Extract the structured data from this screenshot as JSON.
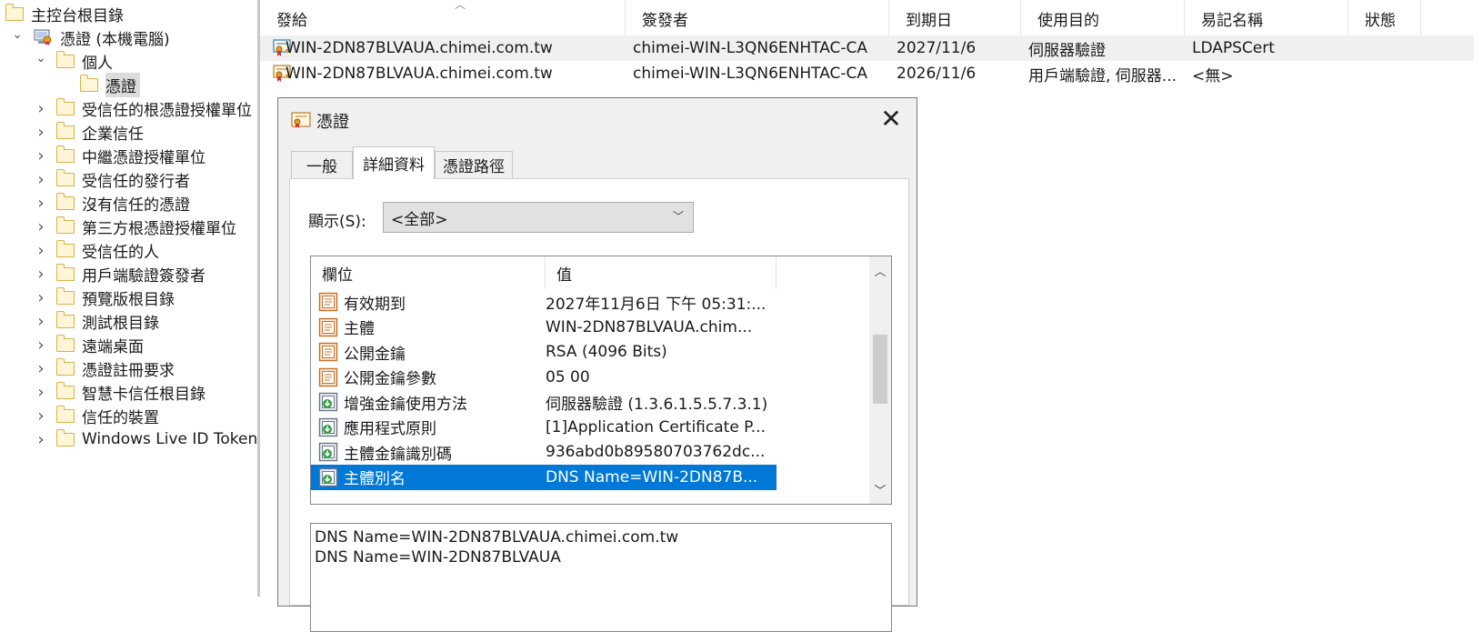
{
  "tree": {
    "items": [
      {
        "label": "主控台根目錄",
        "level": 0,
        "icon": "folder-icon",
        "expander": ""
      },
      {
        "label": "憑證 (本機電腦)",
        "level": 1,
        "icon": "certificate-computer-icon",
        "expander": "expanded"
      },
      {
        "label": "個人",
        "level": 2,
        "icon": "folder-icon",
        "expander": "expanded"
      },
      {
        "label": "憑證",
        "level": 3,
        "icon": "folder-icon",
        "expander": "",
        "selected": true
      },
      {
        "label": "受信任的根憑證授權單位",
        "level": 2,
        "icon": "folder-icon",
        "expander": "collapsed"
      },
      {
        "label": "企業信任",
        "level": 2,
        "icon": "folder-icon",
        "expander": "collapsed"
      },
      {
        "label": "中繼憑證授權單位",
        "level": 2,
        "icon": "folder-icon",
        "expander": "collapsed"
      },
      {
        "label": "受信任的發行者",
        "level": 2,
        "icon": "folder-icon",
        "expander": "collapsed"
      },
      {
        "label": "沒有信任的憑證",
        "level": 2,
        "icon": "folder-icon",
        "expander": "collapsed"
      },
      {
        "label": "第三方根憑證授權單位",
        "level": 2,
        "icon": "folder-icon",
        "expander": "collapsed"
      },
      {
        "label": "受信任的人",
        "level": 2,
        "icon": "folder-icon",
        "expander": "collapsed"
      },
      {
        "label": "用戶端驗證簽發者",
        "level": 2,
        "icon": "folder-icon",
        "expander": "collapsed"
      },
      {
        "label": "預覽版根目錄",
        "level": 2,
        "icon": "folder-icon",
        "expander": "collapsed"
      },
      {
        "label": "測試根目錄",
        "level": 2,
        "icon": "folder-icon",
        "expander": "collapsed"
      },
      {
        "label": "遠端桌面",
        "level": 2,
        "icon": "folder-icon",
        "expander": "collapsed"
      },
      {
        "label": "憑證註冊要求",
        "level": 2,
        "icon": "folder-icon",
        "expander": "collapsed"
      },
      {
        "label": "智慧卡信任根目錄",
        "level": 2,
        "icon": "folder-icon",
        "expander": "collapsed"
      },
      {
        "label": "信任的裝置",
        "level": 2,
        "icon": "folder-icon",
        "expander": "collapsed"
      },
      {
        "label": "Windows Live ID Token",
        "level": 2,
        "icon": "folder-icon",
        "expander": "collapsed"
      }
    ]
  },
  "list": {
    "columns": [
      "發給",
      "簽發者",
      "到期日",
      "使用目的",
      "易記名稱",
      "狀態"
    ],
    "rows": [
      {
        "issued_to": "WIN-2DN87BLVAUA.chimei.com.tw",
        "issuer": "chimei-WIN-L3QN6ENHTAC-CA",
        "expires": "2027/11/6",
        "purpose": "伺服器驗證",
        "friendly": "LDAPSCert",
        "status": "",
        "selected": true
      },
      {
        "issued_to": "WIN-2DN87BLVAUA.chimei.com.tw",
        "issuer": "chimei-WIN-L3QN6ENHTAC-CA",
        "expires": "2026/11/6",
        "purpose": "用戶端驗證, 伺服器...",
        "friendly": "<無>",
        "status": "",
        "selected": false
      }
    ]
  },
  "dialog": {
    "title": "憑證",
    "close_glyph": "✕",
    "tabs": [
      "一般",
      "詳細資料",
      "憑證路徑"
    ],
    "active_tab": 1,
    "show_label": "顯示(S):",
    "show_value": "<全部>",
    "grid_headers": [
      "欄位",
      "值"
    ],
    "fields": [
      {
        "field": "有效期到",
        "value": "2027年11月6日 下午 05:31:...",
        "icon": "cert-property-icon"
      },
      {
        "field": "主體",
        "value": "WIN-2DN87BLVAUA.chim...",
        "icon": "cert-property-icon"
      },
      {
        "field": "公開金鑰",
        "value": "RSA (4096 Bits)",
        "icon": "cert-property-icon"
      },
      {
        "field": "公開金鑰參數",
        "value": "05 00",
        "icon": "cert-property-icon"
      },
      {
        "field": "增強金鑰使用方法",
        "value": "伺服器驗證 (1.3.6.1.5.5.7.3.1)",
        "icon": "cert-extension-icon"
      },
      {
        "field": "應用程式原則",
        "value": "[1]Application Certificate P...",
        "icon": "cert-extension-icon"
      },
      {
        "field": "主體金鑰識別碼",
        "value": "936abd0b89580703762dc...",
        "icon": "cert-extension-icon"
      },
      {
        "field": "主體別名",
        "value": "DNS Name=WIN-2DN87B...",
        "icon": "cert-extension-icon",
        "selected": true
      }
    ],
    "detail_text": "DNS Name=WIN-2DN87BLVAUA.chimei.com.tw\nDNS Name=WIN-2DN87BLVAUA"
  },
  "colors": {
    "selection_blue": "#0078d7",
    "folder_fill": "#fff6d8",
    "folder_border": "#d9b04a"
  }
}
